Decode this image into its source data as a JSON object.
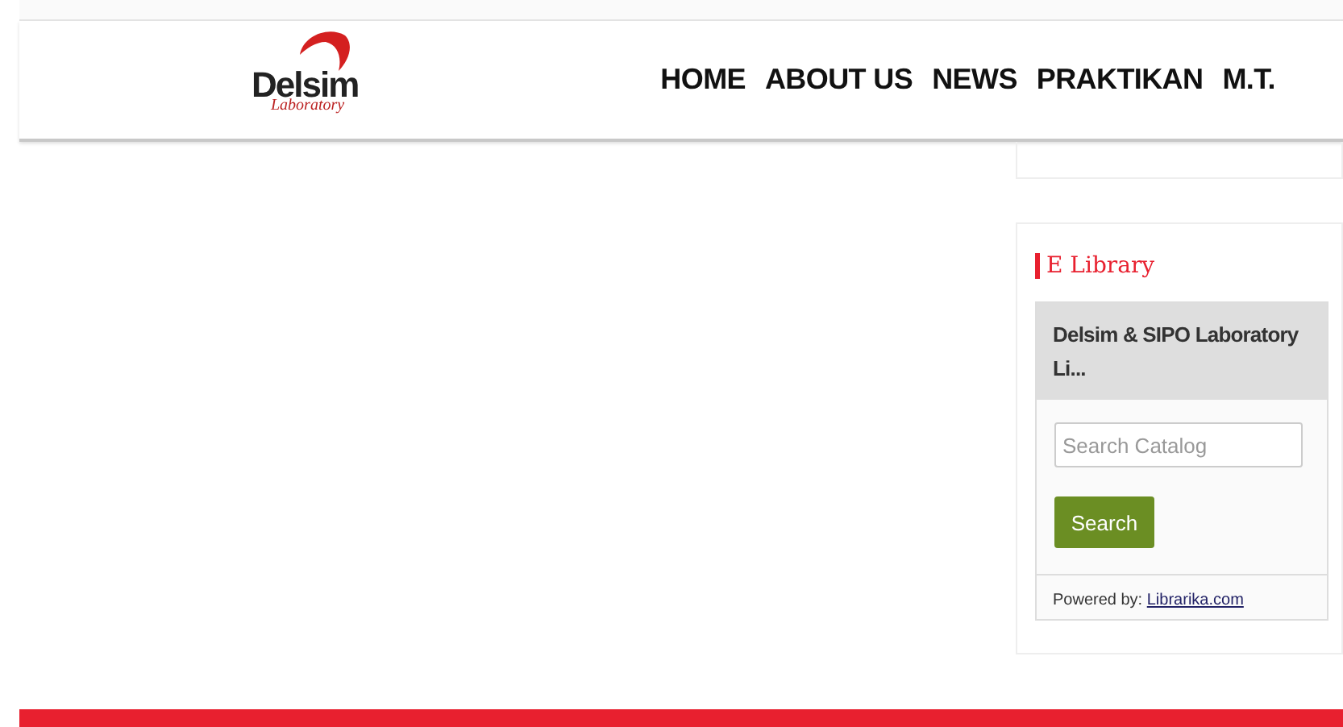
{
  "logo": {
    "title": "Delsim",
    "subtitle": "Laboratory"
  },
  "nav": [
    {
      "label": "HOME"
    },
    {
      "label": "ABOUT US"
    },
    {
      "label": "NEWS"
    },
    {
      "label": "PRAKTIKAN"
    },
    {
      "label": "M.T."
    }
  ],
  "widget": {
    "title": "E Library",
    "library_name": "Delsim & SIPO Laboratory Li...",
    "search": {
      "placeholder": "Search Catalog"
    },
    "button": "Search",
    "powered_label": "Powered by:",
    "powered_link": "Librarika.com"
  }
}
